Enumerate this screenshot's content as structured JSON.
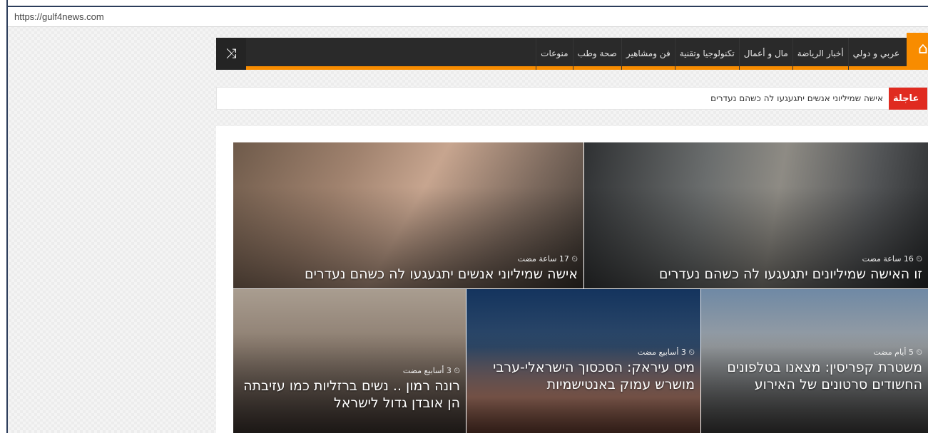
{
  "browser": {
    "url": "https://gulf4news.com"
  },
  "nav": {
    "shuffle_icon": "shuffle-icon",
    "home_icon": "home-icon",
    "items": [
      "عربي و دولي",
      "أخبار الرياضة",
      "مال و أعمال",
      "تكنولوجيا وتقنية",
      "فن ومشاهير",
      "صحة وطب",
      "منوعات"
    ],
    "accent_color": "#f88c00"
  },
  "ticker": {
    "label": "عاجلة",
    "text": "אישה שמיליוני אנשים יתגעגעו לה כשהם נעדרים",
    "label_color": "#e02b20"
  },
  "articles": [
    {
      "time": "17 ساعة مضت",
      "title": "אישה שמיליוני אנשים יתגעגעו לה כשהם נעדרים"
    },
    {
      "time": "16 ساعة مضت",
      "title": "זו האישה שמיליונים יתגעגעו לה כשהם נעדרים"
    },
    {
      "time": "3 أسابيع مضت",
      "title": "רונה רמון .. נשים ברזליות כמו עזיבתה הן אובדן גדול לישראל"
    },
    {
      "time": "3 أسابيع مضت",
      "title": "מיס עיראק: הסכסוך הישראלי-ערבי מושרש עמוק באנטישמיות"
    },
    {
      "time": "5 أيام مضت",
      "title": "משטרת קפריסין: מצאנו בטלפונים החשודים סרטונים של האירוע"
    }
  ]
}
